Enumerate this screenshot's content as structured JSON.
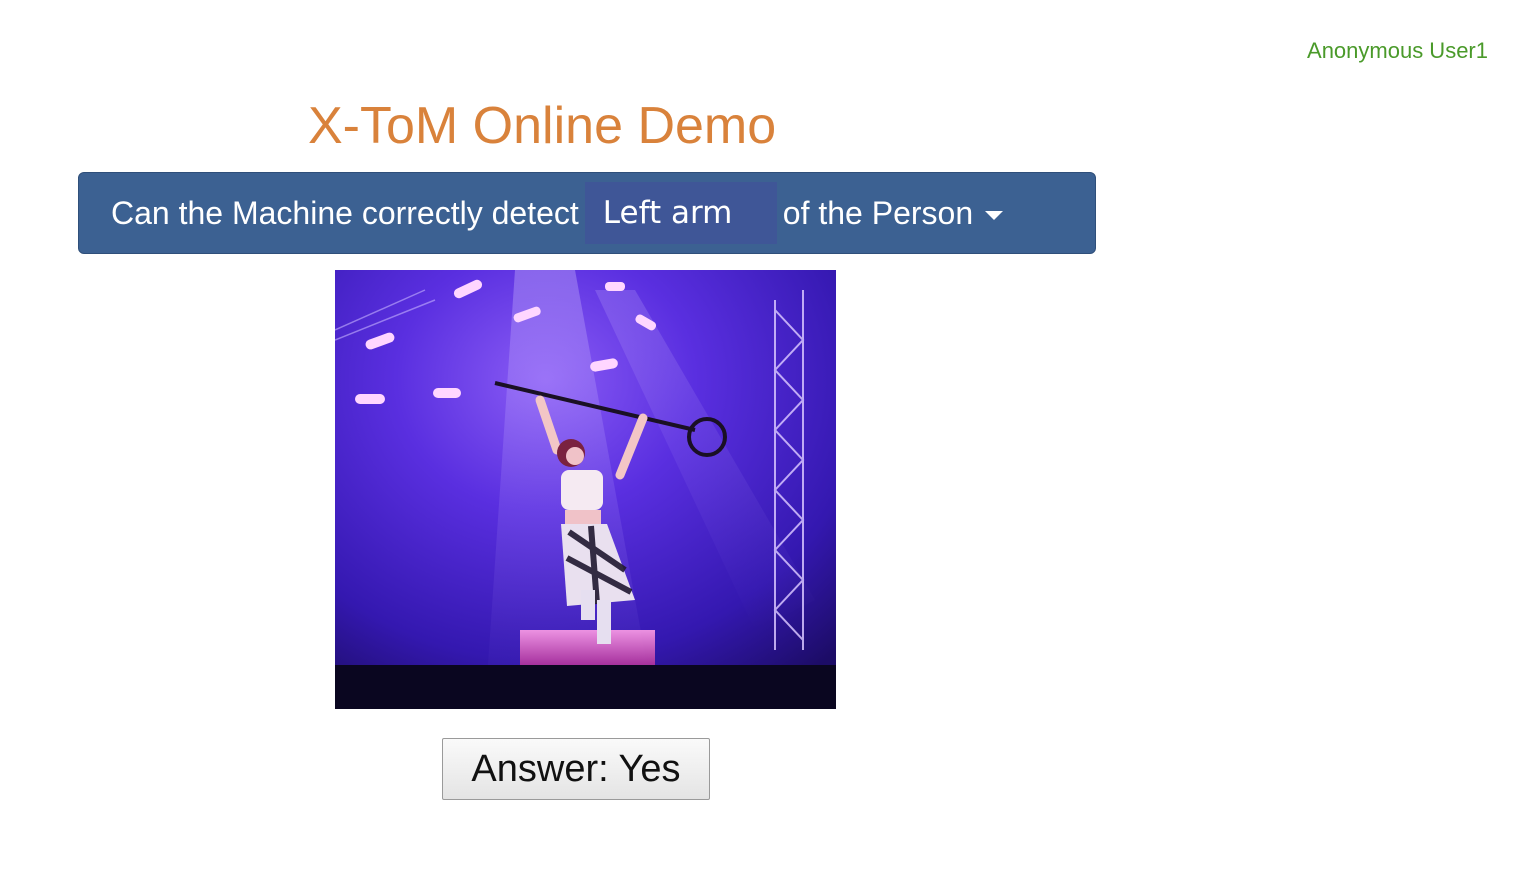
{
  "header": {
    "user_name": "Anonymous User1"
  },
  "main": {
    "title": "X-ToM Online Demo",
    "question": {
      "prefix": "Can the Machine correctly detect",
      "selected_part": "Left arm",
      "suffix": "of the Person"
    },
    "answer_label": "Answer: Yes"
  },
  "colors": {
    "title": "#d9823b",
    "user_name": "#4a9a2a",
    "question_bar": "#3c6192",
    "part_select": "#3f5697"
  },
  "icons": {
    "dropdown": "caret-down-icon"
  }
}
